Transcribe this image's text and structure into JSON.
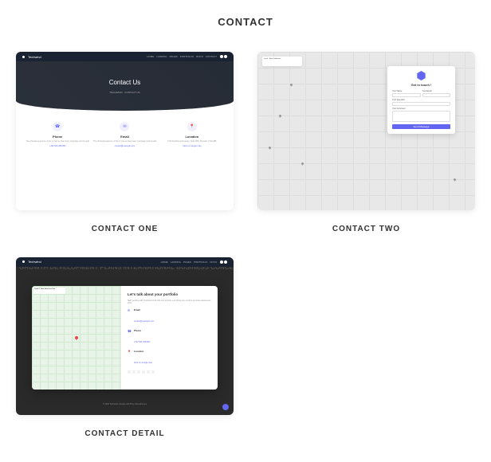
{
  "page_title": "CONTACT",
  "cards": [
    {
      "label": "CONTACT ONE"
    },
    {
      "label": "CONTACT TWO"
    },
    {
      "label": "CONTACT DETAIL"
    }
  ],
  "thumb1": {
    "brand": "Techwind",
    "nav": [
      "HOME",
      "LANDING",
      "PAGES",
      "PORTFOLIO",
      "DOCS",
      "CONTACT"
    ],
    "hero_title": "Contact Us",
    "breadcrumb": "TECHWIND · CONTACT US",
    "boxes": [
      {
        "icon": "☎",
        "title": "Phone",
        "desc": "The phrasal sequence of the is now so that many campaign and benefit",
        "link": "+152 534-468-854"
      },
      {
        "icon": "✉",
        "title": "Email",
        "desc": "The phrasal sequence of the is now so that many campaign and benefit",
        "link": "contact@example.com"
      },
      {
        "icon": "📍",
        "title": "Location",
        "desc": "C/54 Northwest Freeway, Suite 558, Houston, USA 485",
        "link": "View on Google map"
      }
    ]
  },
  "thumb2": {
    "address": "Larch · Nine Pemberton",
    "form_title": "Get in touch !",
    "fields": {
      "name_label": "Your Name",
      "name_ph": "Name :",
      "email_label": "Your Email",
      "email_ph": "Email :",
      "question_label": "Your Question",
      "question_ph": "Subject :",
      "comment_label": "Your Comment",
      "comment_ph": "Message :"
    },
    "button": "Send Message"
  },
  "thumb3": {
    "brand": "Techwind",
    "nav": [
      "HOME",
      "LANDING",
      "PAGES",
      "PORTFOLIO",
      "DOCS"
    ],
    "words": [
      "GROWTH",
      "DEVELOPMENT",
      "PLANS",
      "INTERNATIONAL",
      "BUSINESS",
      "CONCEPTS",
      "RESEARCH",
      "SHARE",
      "OPPORTUNITY",
      "TEAMWORK",
      "VISION",
      "ANALYSIS",
      "IDEAS"
    ],
    "map_address": "David S. Neal, Americas Park",
    "panel_title": "Let's talk about your portfolio",
    "panel_desc": "Start working with Techwind CSS that can provide everything you need to generate awareness, drive",
    "items": [
      {
        "icon": "✉",
        "title": "Email",
        "value": "contact@example.com"
      },
      {
        "icon": "☎",
        "title": "Phone",
        "value": "+152 534-468-854"
      },
      {
        "icon": "📍",
        "title": "Location",
        "value": "View on Google map"
      }
    ],
    "footer": "© 2025 Techwind. Design with ❤ by Shreethemes"
  }
}
